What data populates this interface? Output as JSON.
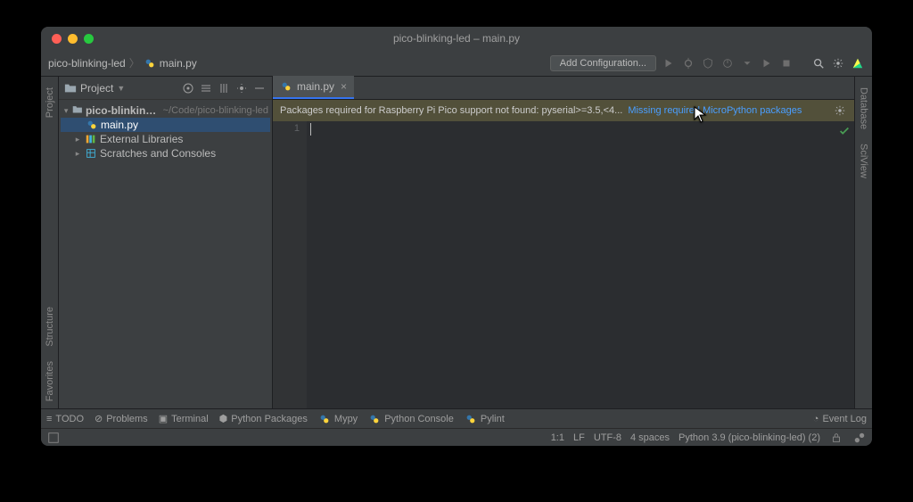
{
  "title": "pico-blinking-led – main.py",
  "breadcrumb": {
    "project": "pico-blinking-led",
    "file": "main.py"
  },
  "toolbar": {
    "add_configuration": "Add Configuration..."
  },
  "left_tools": {
    "project": "Project",
    "structure": "Structure",
    "favorites": "Favorites"
  },
  "right_tools": {
    "database": "Database",
    "sciview": "SciView"
  },
  "sidebar": {
    "title": "Project",
    "root": {
      "name": "pico-blinking-led",
      "path": "~/Code/pico-blinking-led"
    },
    "file": "main.py",
    "ext_libs": "External Libraries",
    "scratches": "Scratches and Consoles"
  },
  "editor": {
    "tab": "main.py",
    "warn_msg": "Packages required for Raspberry Pi Pico support not found: pyserial>=3.5,<4...",
    "warn_link": "Missing required MicroPython packages",
    "line1": "1"
  },
  "bottom": {
    "todo": "TODO",
    "problems": "Problems",
    "terminal": "Terminal",
    "pypkg": "Python Packages",
    "mypy": "Mypy",
    "pyconsole": "Python Console",
    "pylint": "Pylint",
    "eventlog": "Event Log"
  },
  "status": {
    "pos": "1:1",
    "le": "LF",
    "enc": "UTF-8",
    "indent": "4 spaces",
    "interp": "Python 3.9 (pico-blinking-led) (2)"
  }
}
